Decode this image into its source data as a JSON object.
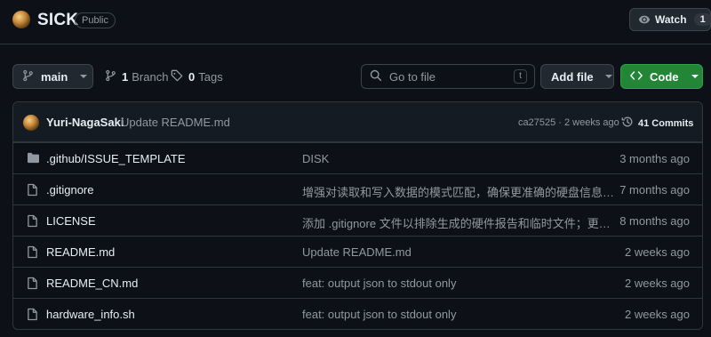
{
  "repo": {
    "name": "SICK",
    "visibility": "Public",
    "watch_label": "Watch",
    "watch_count": "1"
  },
  "toolbar": {
    "branch_name": "main",
    "branch_count": "1",
    "branch_word": "Branch",
    "tag_count": "0",
    "tag_word": "Tags",
    "goto_placeholder": "Go to file",
    "goto_shortcut": "t",
    "add_file_label": "Add file",
    "code_label": "Code"
  },
  "latest_commit": {
    "author": "Yuri-NagaSaki",
    "message": "Update README.md",
    "hash_time": "ca27525 · 2 weeks ago",
    "commits_label": "41 Commits"
  },
  "files": [
    {
      "icon": "folder-icon",
      "name": ".github/ISSUE_TEMPLATE",
      "message": "DISK",
      "date": "3 months ago"
    },
    {
      "icon": "file-icon",
      "name": ".gitignore",
      "message": "增强对读取和写入数据的模式匹配，确保更准确的硬盘信息…",
      "date": "7 months ago"
    },
    {
      "icon": "file-icon",
      "name": "LICENSE",
      "message": "添加 .gitignore 文件以排除生成的硬件报告和临时文件；更…",
      "date": "8 months ago"
    },
    {
      "icon": "file-icon",
      "name": "README.md",
      "message": "Update README.md",
      "date": "2 weeks ago"
    },
    {
      "icon": "file-icon",
      "name": "README_CN.md",
      "message": "feat: output json to stdout only",
      "date": "2 weeks ago"
    },
    {
      "icon": "file-icon",
      "name": "hardware_info.sh",
      "message": "feat: output json to stdout only",
      "date": "2 weeks ago"
    }
  ],
  "colors": {
    "background": "#0d1117",
    "border": "#30363d",
    "muted_text": "#9198a1",
    "code_button": "#238636"
  }
}
